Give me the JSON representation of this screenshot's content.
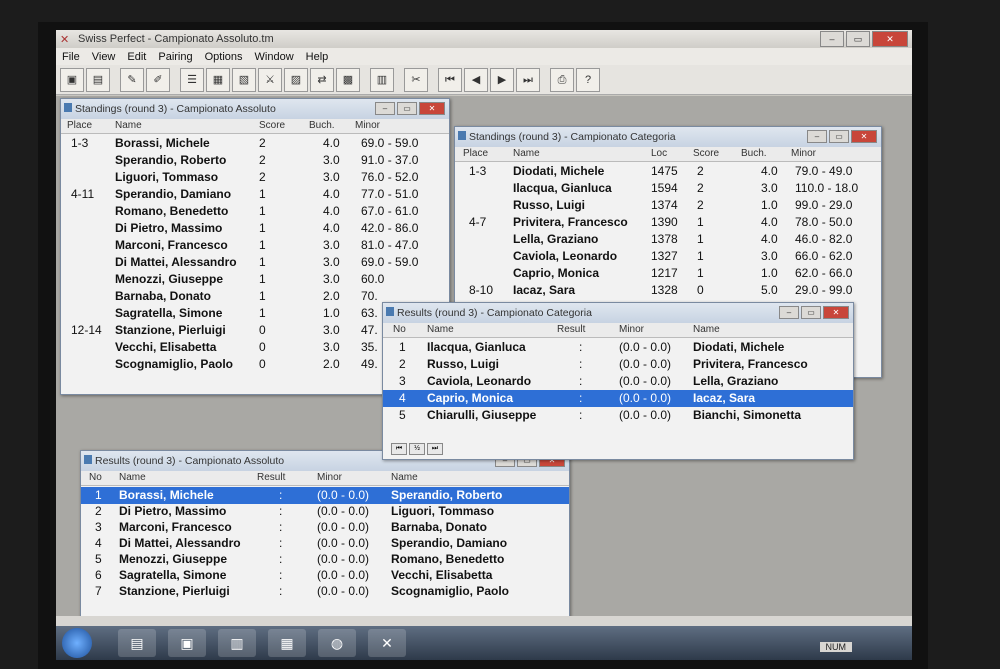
{
  "app": {
    "title": "Swiss Perfect - Campionato Assoluto.tm"
  },
  "menu": [
    "File",
    "View",
    "Edit",
    "Pairing",
    "Options",
    "Window",
    "Help"
  ],
  "standings_assoluto": {
    "title": "Standings  (round 3) - Campionato Assoluto",
    "headers": [
      "Place",
      "Name",
      "Score",
      "Buch.",
      "Minor"
    ],
    "rows": [
      {
        "place": "1-3",
        "name": "Borassi, Michele",
        "score": "2",
        "buch": "4.0",
        "minor": "69.0  -  59.0"
      },
      {
        "place": "",
        "name": "Sperandio, Roberto",
        "score": "2",
        "buch": "3.0",
        "minor": "91.0  -  37.0"
      },
      {
        "place": "",
        "name": "Liguori, Tommaso",
        "score": "2",
        "buch": "3.0",
        "minor": "76.0  -  52.0"
      },
      {
        "place": "4-11",
        "name": "Sperandio, Damiano",
        "score": "1",
        "buch": "4.0",
        "minor": "77.0  -  51.0"
      },
      {
        "place": "",
        "name": "Romano, Benedetto",
        "score": "1",
        "buch": "4.0",
        "minor": "67.0  -  61.0"
      },
      {
        "place": "",
        "name": "Di Pietro, Massimo",
        "score": "1",
        "buch": "4.0",
        "minor": "42.0  -  86.0"
      },
      {
        "place": "",
        "name": "Marconi, Francesco",
        "score": "1",
        "buch": "3.0",
        "minor": "81.0  -  47.0"
      },
      {
        "place": "",
        "name": "Di Mattei, Alessandro",
        "score": "1",
        "buch": "3.0",
        "minor": "69.0  -  59.0"
      },
      {
        "place": "",
        "name": "Menozzi, Giuseppe",
        "score": "1",
        "buch": "3.0",
        "minor": "60.0"
      },
      {
        "place": "",
        "name": "Barnaba, Donato",
        "score": "1",
        "buch": "2.0",
        "minor": "70."
      },
      {
        "place": "",
        "name": "Sagratella, Simone",
        "score": "1",
        "buch": "1.0",
        "minor": "63."
      },
      {
        "place": "12-14",
        "name": "Stanzione, Pierluigi",
        "score": "0",
        "buch": "3.0",
        "minor": "47."
      },
      {
        "place": "",
        "name": "Vecchi, Elisabetta",
        "score": "0",
        "buch": "3.0",
        "minor": "35."
      },
      {
        "place": "",
        "name": "Scognamiglio, Paolo",
        "score": "0",
        "buch": "2.0",
        "minor": "49."
      }
    ]
  },
  "standings_categoria": {
    "title": "Standings  (round 3) - Campionato Categoria",
    "headers": [
      "Place",
      "Name",
      "Loc",
      "Score",
      "Buch.",
      "Minor"
    ],
    "rows": [
      {
        "place": "1-3",
        "name": "Diodati, Michele",
        "loc": "1475",
        "score": "2",
        "buch": "4.0",
        "minor": "79.0  -  49.0"
      },
      {
        "place": "",
        "name": "Ilacqua, Gianluca",
        "loc": "1594",
        "score": "2",
        "buch": "3.0",
        "minor": "110.0  -  18.0"
      },
      {
        "place": "",
        "name": "Russo, Luigi",
        "loc": "1374",
        "score": "2",
        "buch": "1.0",
        "minor": "99.0  -  29.0"
      },
      {
        "place": "4-7",
        "name": "Privitera, Francesco",
        "loc": "1390",
        "score": "1",
        "buch": "4.0",
        "minor": "78.0  -  50.0"
      },
      {
        "place": "",
        "name": "Lella, Graziano",
        "loc": "1378",
        "score": "1",
        "buch": "4.0",
        "minor": "46.0  -  82.0"
      },
      {
        "place": "",
        "name": "Caviola, Leonardo",
        "loc": "1327",
        "score": "1",
        "buch": "3.0",
        "minor": "66.0  -  62.0"
      },
      {
        "place": "",
        "name": "Caprio, Monica",
        "loc": "1217",
        "score": "1",
        "buch": "1.0",
        "minor": "62.0  -  66.0"
      },
      {
        "place": "8-10",
        "name": "Iacaz, Sara",
        "loc": "1328",
        "score": "0",
        "buch": "5.0",
        "minor": "29.0  -  99.0"
      }
    ]
  },
  "results_categoria": {
    "title": "Results  (round 3) - Campionato Categoria",
    "headers": [
      "No",
      "Name",
      "Result",
      "Minor",
      "Name"
    ],
    "rows": [
      {
        "no": "1",
        "white": "Ilacqua, Gianluca",
        "result": ":",
        "minor": "(0.0  -  0.0)",
        "black": "Diodati, Michele"
      },
      {
        "no": "2",
        "white": "Russo, Luigi",
        "result": ":",
        "minor": "(0.0  -  0.0)",
        "black": "Privitera, Francesco"
      },
      {
        "no": "3",
        "white": "Caviola, Leonardo",
        "result": ":",
        "minor": "(0.0  -  0.0)",
        "black": "Lella, Graziano"
      },
      {
        "no": "4",
        "white": "Caprio, Monica",
        "result": ":",
        "minor": "(0.0  -  0.0)",
        "black": "Iacaz, Sara"
      },
      {
        "no": "5",
        "white": "Chiarulli, Giuseppe",
        "result": ":",
        "minor": "(0.0  -  0.0)",
        "black": "Bianchi, Simonetta"
      }
    ],
    "selected": 3
  },
  "results_assoluto": {
    "title": "Results  (round 3) - Campionato Assoluto",
    "headers": [
      "No",
      "Name",
      "Result",
      "Minor",
      "Name"
    ],
    "rows": [
      {
        "no": "1",
        "white": "Borassi, Michele",
        "result": ":",
        "minor": "(0.0  -  0.0)",
        "black": "Sperandio, Roberto"
      },
      {
        "no": "2",
        "white": "Di Pietro, Massimo",
        "result": ":",
        "minor": "(0.0  -  0.0)",
        "black": "Liguori, Tommaso"
      },
      {
        "no": "3",
        "white": "Marconi, Francesco",
        "result": ":",
        "minor": "(0.0  -  0.0)",
        "black": "Barnaba, Donato"
      },
      {
        "no": "4",
        "white": "Di Mattei, Alessandro",
        "result": ":",
        "minor": "(0.0  -  0.0)",
        "black": "Sperandio, Damiano"
      },
      {
        "no": "5",
        "white": "Menozzi, Giuseppe",
        "result": ":",
        "minor": "(0.0  -  0.0)",
        "black": "Romano, Benedetto"
      },
      {
        "no": "6",
        "white": "Sagratella, Simone",
        "result": ":",
        "minor": "(0.0  -  0.0)",
        "black": "Vecchi, Elisabetta"
      },
      {
        "no": "7",
        "white": "Stanzione, Pierluigi",
        "result": ":",
        "minor": "(0.0  -  0.0)",
        "black": "Scognamiglio, Paolo"
      }
    ],
    "selected": 0
  },
  "status": {
    "num": "NUM"
  }
}
